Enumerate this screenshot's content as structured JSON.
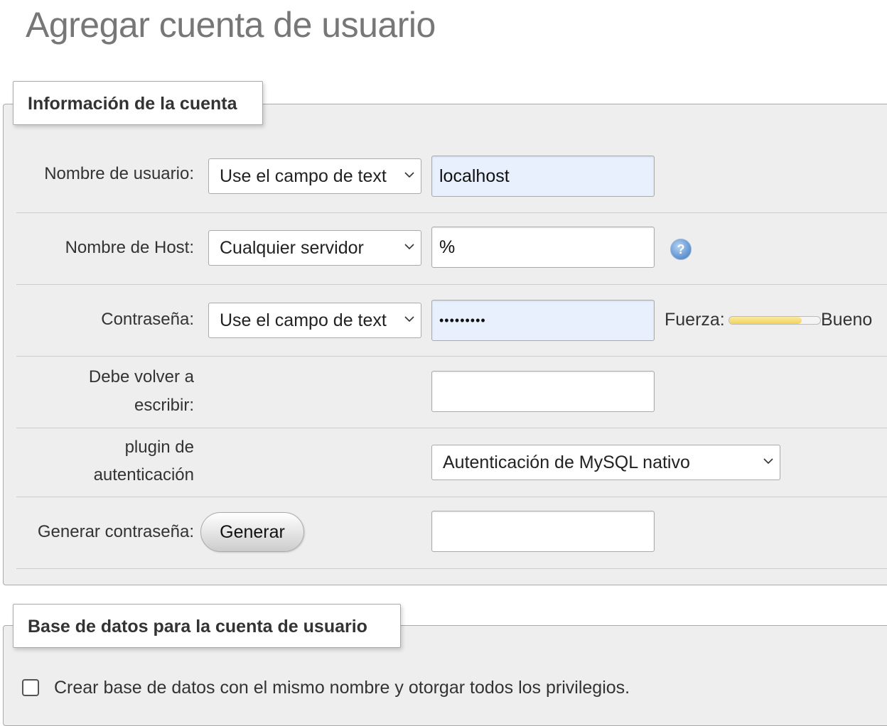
{
  "page": {
    "title": "Agregar cuenta de usuario"
  },
  "account_info": {
    "legend": "Información de la cuenta",
    "username": {
      "label": "Nombre de usuario:",
      "select_value": "Use el campo de text",
      "input_value": "localhost"
    },
    "hostname": {
      "label": "Nombre de Host:",
      "select_value": "Cualquier servidor",
      "input_value": "%",
      "help_icon": "help-icon"
    },
    "password": {
      "label": "Contraseña:",
      "select_value": "Use el campo de text",
      "input_value": "•••••••••",
      "strength_label": "Fuerza:",
      "strength_fraction": 0.8,
      "strength_text": "Bueno"
    },
    "retype": {
      "label_line1": "Debe volver a",
      "label_line2": "escribir:",
      "input_value": ""
    },
    "auth_plugin": {
      "label_line1": "plugin de",
      "label_line2": "autenticación",
      "select_value": "Autenticación de MySQL nativo"
    },
    "generate": {
      "label": "Generar contraseña:",
      "button_label": "Generar",
      "input_value": ""
    }
  },
  "database": {
    "legend": "Base de datos para la cuenta de usuario",
    "create_db_label": "Crear base de datos con el mismo nombre y otorgar todos los privilegios.",
    "create_db_checked": false
  },
  "colors": {
    "fieldset_bg": "#eeeeee",
    "autofill_bg": "#e8f0fe",
    "strength_bar": "#f2d35a"
  }
}
